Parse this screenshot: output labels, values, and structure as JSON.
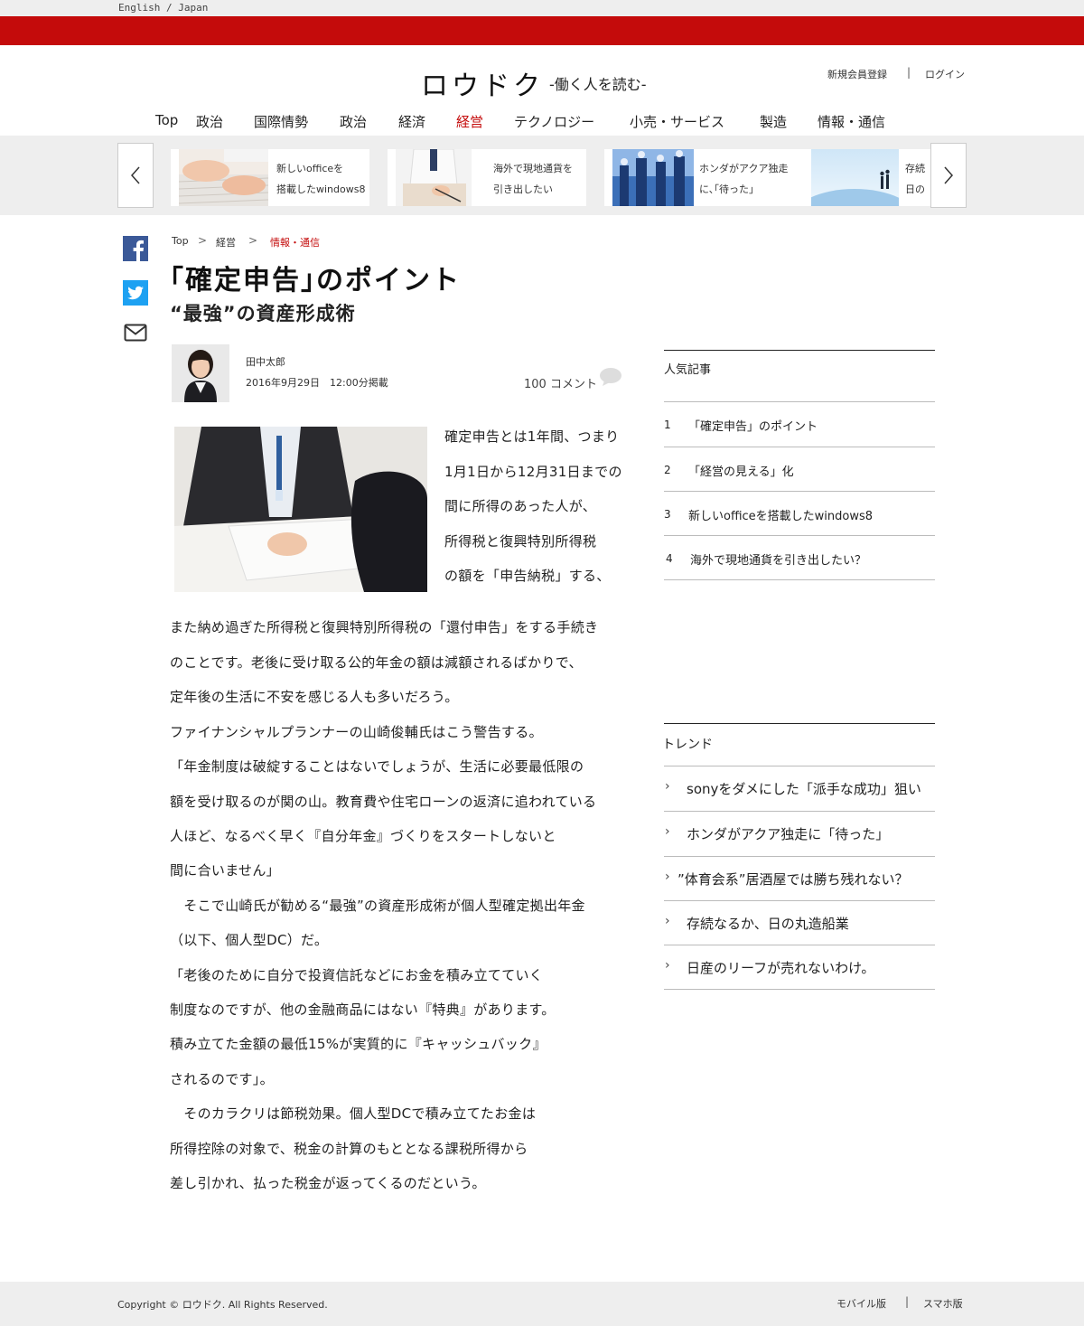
{
  "topbar": {
    "language": "English / Japan"
  },
  "header": {
    "logo": "ロウドク",
    "tagline": "-働く人を読む-",
    "register": "新規会員登録",
    "separator": "|",
    "login": "ログイン"
  },
  "nav": {
    "items": [
      "Top",
      "政治",
      "国際情勢",
      "政治",
      "経済",
      "経営",
      "テクノロジー",
      "小売・サービス",
      "製造",
      "情報・通信"
    ],
    "active_index": 5,
    "active_color": "#c40b0b"
  },
  "carousel": {
    "cards": [
      {
        "text": "新しいofficeを\n搭載したwindows8",
        "thumb": "keyboard-photo"
      },
      {
        "text": "海外で現地通貨を\n引き出したい",
        "thumb": "office-worker-photo"
      },
      {
        "text": "ホンダがアクア独走\nに､｢待った｣",
        "thumb": "business-people-photo"
      },
      {
        "text": "存続\n日の",
        "thumb": "sky-people-photo"
      }
    ],
    "prev_icon": "chevron-left-icon",
    "next_icon": "chevron-right-icon"
  },
  "social": [
    "facebook-icon",
    "twitter-icon",
    "mail-icon"
  ],
  "breadcrumb": {
    "items": [
      "Top",
      "経営",
      "情報・通信"
    ],
    "separator": ">"
  },
  "article": {
    "title": "｢確定申告｣のポイント",
    "subtitle": "“最強”の資産形成術",
    "author": "田中太郎",
    "date": "2016年9月29日　12:00分掲載",
    "comments": "100 コメント",
    "lines_beside_photo": [
      "確定申告とは1年間、つまり",
      "1月1日から12月31日までの",
      "間に所得のあった人が、",
      "所得税と復興特別所得税",
      "の額を「申告納税」する、"
    ],
    "lines": [
      "また納め過ぎた所得税と復興特別所得税の「還付申告」をする手続き",
      "のことです。老後に受け取る公的年金の額は減額されるばかりで、",
      "定年後の生活に不安を感じる人も多いだろう。",
      "ファイナンシャルプランナーの山崎俊輔氏はこう警告する。",
      "「年金制度は破綻することはないでしょうが、生活に必要最低限の",
      "額を受け取るのが関の山。教育費や住宅ローンの返済に追われている",
      "人ほど、なるべく早く『自分年金』づくりをスタートしないと",
      "間に合いません」",
      "　そこで山崎氏が勧める“最強”の資産形成術が個人型確定拠出年金",
      "（以下、個人型DC）だ。",
      "「老後のために自分で投資信託などにお金を積み立てていく",
      "制度なのですが、他の金融商品にはない『特典』があります。",
      "積み立てた金額の最低15%が実質的に『キャッシュバック』",
      "されるのです」。",
      "　そのカラクリは節税効果。個人型DCで積み立てたお金は",
      "所得控除の対象で、税金の計算のもととなる課税所得から",
      "差し引かれ、払った税金が返ってくるのだという。"
    ]
  },
  "popular": {
    "heading": "人気記事",
    "items": [
      {
        "rank": "1",
        "title": "「確定申告」のポイント"
      },
      {
        "rank": "2",
        "title": "「経営の見える」化"
      },
      {
        "rank": "3",
        "title": "新しいofficeを搭載したwindows8"
      },
      {
        "rank": "4",
        "title": "海外で現地通貨を引き出したい？"
      }
    ]
  },
  "trend": {
    "heading": "トレンド",
    "items": [
      "sonyをダメにした「派手な成功」狙い",
      "ホンダがアクア独走に「待った」",
      "”体育会系”居酒屋では勝ち残れない？",
      "存続なるか、日の丸造船業",
      "日産のリーフが売れないわけ。"
    ]
  },
  "footer": {
    "copyright": "Copyright © ロウドク. All Rights Reserved.",
    "mobile": "モバイル版",
    "separator": "|",
    "smartphone": "スマホ版"
  },
  "colors": {
    "brand_red": "#c40b0b",
    "gray_band": "#eeeeee"
  }
}
